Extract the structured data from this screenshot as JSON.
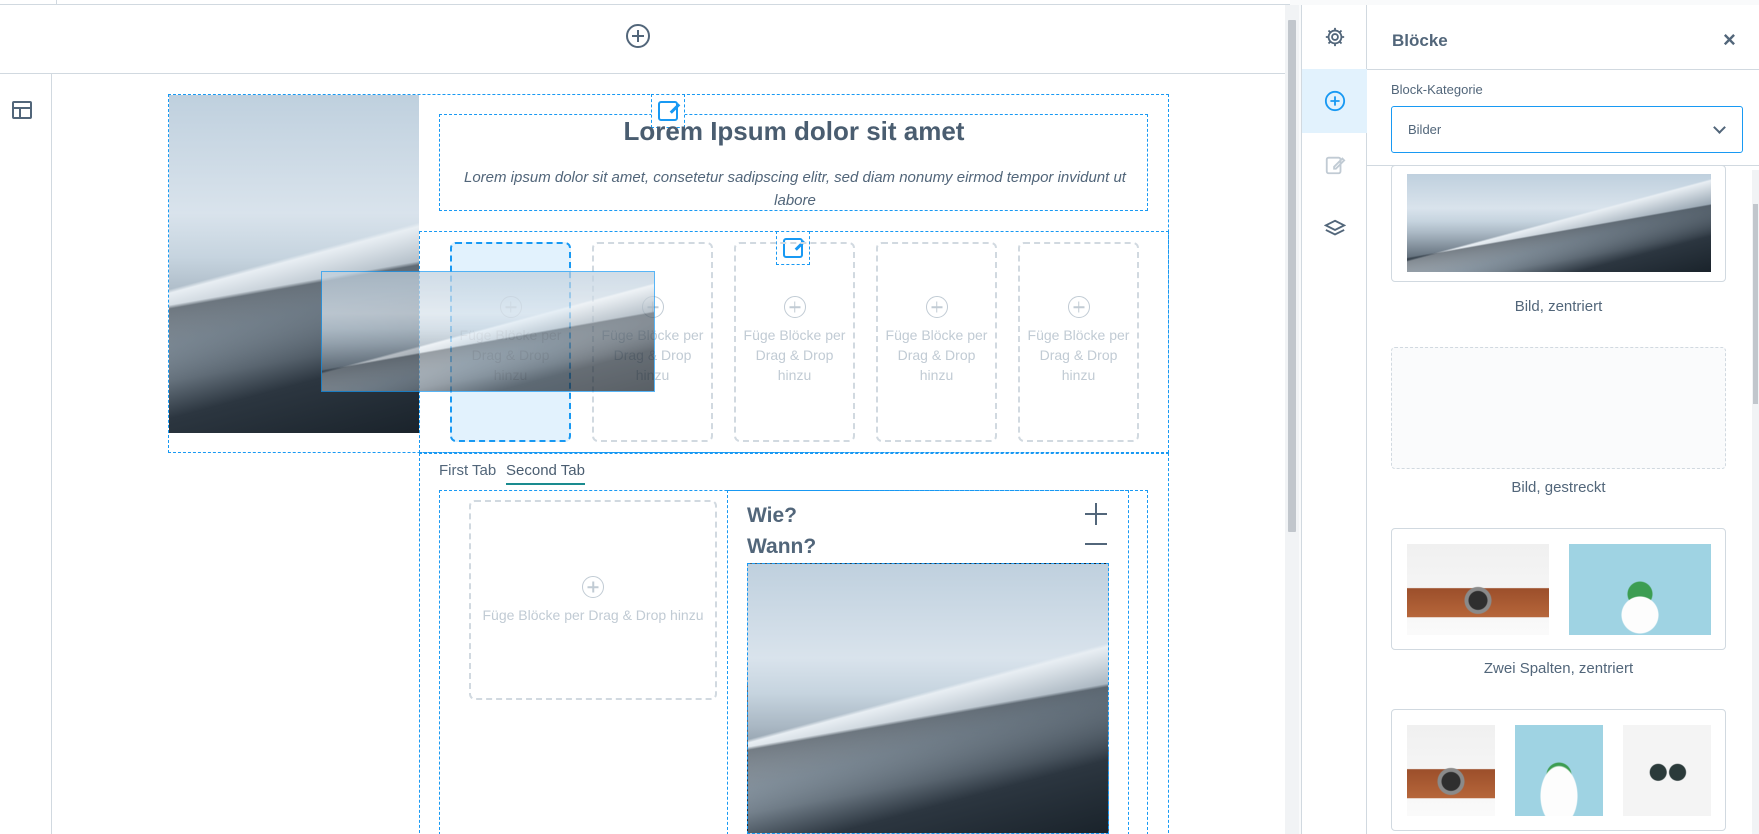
{
  "canvas": {
    "heading": "Lorem Ipsum dolor sit amet",
    "lead": "Lorem ipsum dolor sit amet, consetetur sadipscing elitr, sed diam nonumy eirmod tempor invidunt ut labore",
    "dropzone_text": "Füge Blöcke per Drag & Drop hinzu",
    "tabs": [
      "First Tab",
      "Second Tab"
    ],
    "active_tab": "Second Tab",
    "faq": [
      "Wie?",
      "Wann?"
    ]
  },
  "sidebar_icons": [
    {
      "name": "settings",
      "icon": "gear-icon"
    },
    {
      "name": "blocks",
      "icon": "plus-circle-icon",
      "active": true
    },
    {
      "name": "edit",
      "icon": "edit-icon"
    },
    {
      "name": "layers",
      "icon": "layers-icon"
    }
  ],
  "panel": {
    "title": "Blöcke",
    "close_label": "×",
    "category_label": "Block-Kategorie",
    "category_value": "Bilder",
    "blocks": [
      {
        "label": "Bild, zentriert"
      },
      {
        "label": "Bild, gestreckt"
      },
      {
        "label": "Zwei Spalten, zentriert"
      },
      {
        "label": ""
      }
    ]
  },
  "colors": {
    "accent": "#1899f3",
    "text": "#52667a",
    "border": "#d1d9e0",
    "active_bg": "#e2f2fd",
    "tab_underline": "#1a8b8f"
  }
}
